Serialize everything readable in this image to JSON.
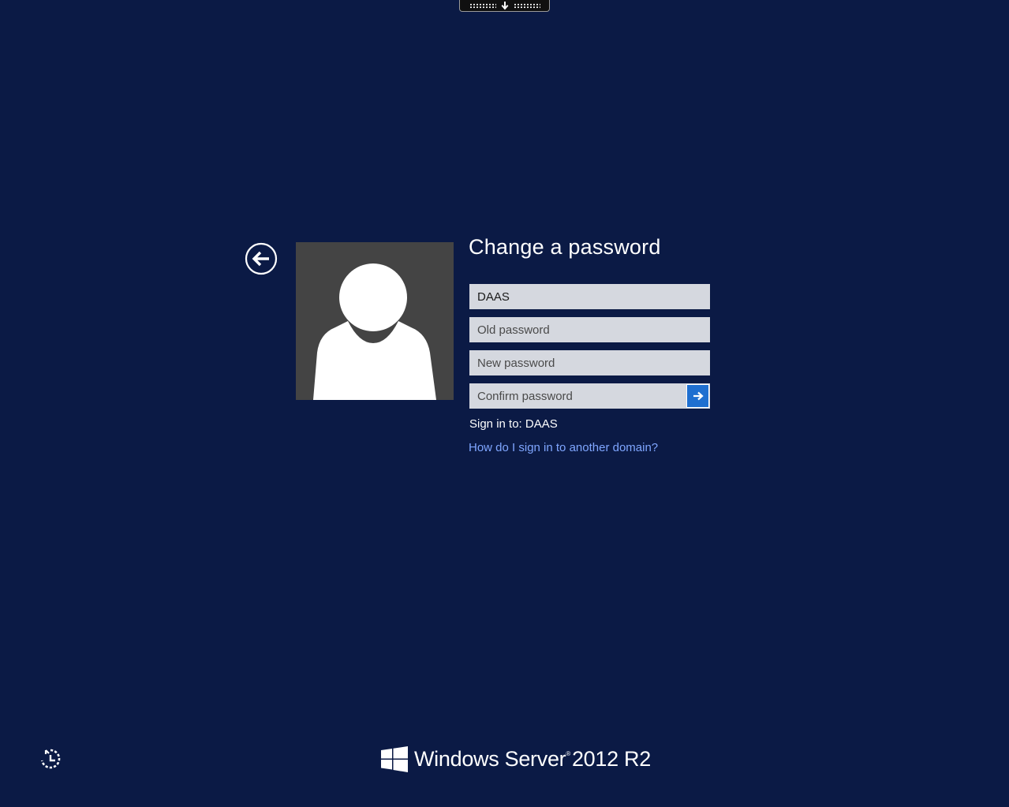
{
  "connection_bar": {
    "pin_icon": "down-arrow-icon"
  },
  "back_button": {
    "icon": "back-arrow-circle-icon"
  },
  "user_tile": {
    "icon": "default-user-silhouette-icon",
    "background": "#444444"
  },
  "form": {
    "title": "Change a password",
    "username_value": "DAAS",
    "old_password_placeholder": "Old password",
    "new_password_placeholder": "New password",
    "confirm_password_placeholder": "Confirm password",
    "submit_icon": "right-arrow-icon",
    "sign_in_to_label": "Sign in to: DAAS",
    "other_domain_link": "How do I sign in to another domain?"
  },
  "ease_of_access": {
    "icon": "ease-of-access-icon"
  },
  "branding": {
    "product_name": "Windows Server",
    "version": "2012 R2",
    "logo_icon": "windows-logo-icon"
  },
  "colors": {
    "background": "#0b1a45",
    "accent_button": "#1f6fd0",
    "link": "#7fa6ff",
    "field_background": "#d5d8df"
  }
}
